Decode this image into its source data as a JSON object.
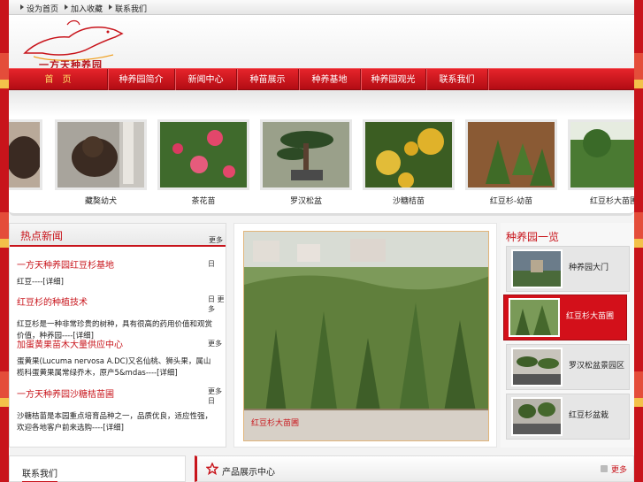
{
  "top_links": [
    "设为首页",
    "加入收藏",
    "联系我们"
  ],
  "logo_text": "一方天种养园",
  "nav": [
    "首　页",
    "种养园简介",
    "新闻中心",
    "种苗展示",
    "种养基地",
    "种养园观光",
    "联系我们"
  ],
  "gallery": [
    {
      "caption": "",
      "icon": "dog-photo"
    },
    {
      "caption": "藏獒幼犬",
      "icon": "dog-photo"
    },
    {
      "caption": "茶花苗",
      "icon": "flower-photo"
    },
    {
      "caption": "罗汉松盆",
      "icon": "bonsai-photo"
    },
    {
      "caption": "沙糖桔苗",
      "icon": "orange-photo"
    },
    {
      "caption": "红豆杉-幼苗",
      "icon": "seedling-photo"
    },
    {
      "caption": "红豆杉大苗圃",
      "icon": "grove-photo"
    }
  ],
  "news": {
    "title": "热点新闻",
    "more": "更多",
    "items": [
      {
        "title": "一方天种养园红豆杉基地",
        "meta": "日",
        "excerpt": "红豆----[详细]"
      },
      {
        "title": "红豆杉的种植技术",
        "meta": "日 更多",
        "excerpt": "红豆杉是一种非常珍贵的树种，具有很高的药用价值和观赏价值，种养园----[详细]"
      },
      {
        "title": "加蛋黄果苗木大量供应中心",
        "meta": "更多",
        "excerpt": "蛋黄果(Lucuma nervosa A.DC)又名仙桃、狮头果，属山榄科蛋黄果属常绿乔木，原产5&mdas----[详细]"
      },
      {
        "title": "一方天种养园沙糖桔苗圃",
        "meta": "更多 日",
        "excerpt": "沙糖桔苗是本园重点培育品种之一，品质优良，适应性强，欢迎各地客户前来选购----[详细]"
      }
    ]
  },
  "feature": {
    "caption": "红豆杉大苗圃"
  },
  "park_list": {
    "title": "种养园一览",
    "items": [
      {
        "label": "种养园大门"
      },
      {
        "label": "红豆杉大苗圃",
        "active": true
      },
      {
        "label": "罗汉松盆景园区"
      },
      {
        "label": "红豆杉盆栽"
      }
    ]
  },
  "bottom": {
    "left_title": "联系我们",
    "right_title": "产品展示中心",
    "more": "更多"
  },
  "colors": {
    "brand_red": "#c8141b",
    "nav_red": "#d3101a"
  }
}
